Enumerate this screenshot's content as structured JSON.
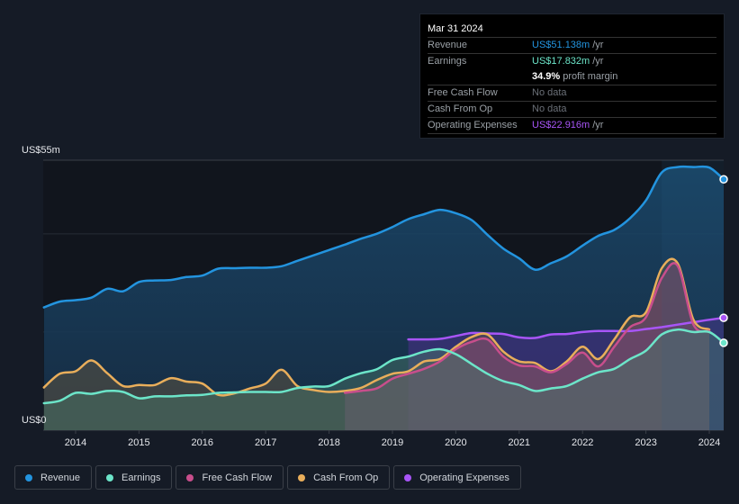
{
  "tooltip": {
    "date": "Mar 31 2024",
    "rows": [
      {
        "label": "Revenue",
        "value": "US$51.138m",
        "unit": "/yr",
        "color": "#2394df"
      },
      {
        "label": "Earnings",
        "value": "US$17.832m",
        "unit": "/yr",
        "color": "#6ce5c9"
      },
      {
        "label": "",
        "value": "34.9%",
        "unit": "profit margin",
        "color": "#ffffff"
      },
      {
        "label": "Free Cash Flow",
        "value": "No data",
        "unit": "",
        "color": "#6b7078"
      },
      {
        "label": "Cash From Op",
        "value": "No data",
        "unit": "",
        "color": "#6b7078"
      },
      {
        "label": "Operating Expenses",
        "value": "US$22.916m",
        "unit": "/yr",
        "color": "#a855f7"
      }
    ]
  },
  "legend": [
    {
      "label": "Revenue",
      "color": "#2394df"
    },
    {
      "label": "Earnings",
      "color": "#6ce5c9"
    },
    {
      "label": "Free Cash Flow",
      "color": "#c84e8c"
    },
    {
      "label": "Cash From Op",
      "color": "#e9ae5b"
    },
    {
      "label": "Operating Expenses",
      "color": "#a855f7"
    }
  ],
  "chart_data": {
    "type": "area",
    "title": "",
    "xlabel": "",
    "ylabel": "",
    "y_tick_labels": [
      "US$0",
      "US$55m"
    ],
    "ylim": [
      0,
      55
    ],
    "xlim": [
      2013.5,
      2024.25
    ],
    "x_ticks": [
      2014,
      2015,
      2016,
      2017,
      2018,
      2019,
      2020,
      2021,
      2022,
      2023,
      2024
    ],
    "grid": true,
    "legend_position": "bottom-left",
    "series": [
      {
        "name": "Revenue",
        "color": "#2394df",
        "x": [
          2013.5,
          2013.75,
          2014.0,
          2014.25,
          2014.5,
          2014.75,
          2015.0,
          2015.25,
          2015.5,
          2015.75,
          2016.0,
          2016.25,
          2016.5,
          2016.75,
          2017.0,
          2017.25,
          2017.5,
          2017.75,
          2018.0,
          2018.25,
          2018.5,
          2018.75,
          2019.0,
          2019.25,
          2019.5,
          2019.75,
          2020.0,
          2020.25,
          2020.5,
          2020.75,
          2021.0,
          2021.25,
          2021.5,
          2021.75,
          2022.0,
          2022.25,
          2022.5,
          2022.75,
          2023.0,
          2023.25,
          2023.5,
          2023.75,
          2024.0,
          2024.25
        ],
        "values": [
          25,
          26.2,
          26.5,
          27,
          28.8,
          28.3,
          30.2,
          30.5,
          30.6,
          31.2,
          31.5,
          32.9,
          33,
          33.1,
          33.1,
          33.4,
          34.5,
          35.6,
          36.7,
          37.8,
          39,
          40,
          41.4,
          43,
          44,
          44.9,
          44.2,
          42.8,
          39.8,
          37,
          35,
          32.7,
          34,
          35.4,
          37.6,
          39.6,
          40.8,
          43.2,
          46.8,
          52.5,
          53.6,
          53.6,
          53.5,
          51.1
        ]
      },
      {
        "name": "Earnings",
        "color": "#6ce5c9",
        "x": [
          2013.5,
          2013.75,
          2014.0,
          2014.25,
          2014.5,
          2014.75,
          2015.0,
          2015.25,
          2015.5,
          2015.75,
          2016.0,
          2016.25,
          2016.5,
          2016.75,
          2017.0,
          2017.25,
          2017.5,
          2017.75,
          2018.0,
          2018.25,
          2018.5,
          2018.75,
          2019.0,
          2019.25,
          2019.5,
          2019.75,
          2020.0,
          2020.25,
          2020.5,
          2020.75,
          2021.0,
          2021.25,
          2021.5,
          2021.75,
          2022.0,
          2022.25,
          2022.5,
          2022.75,
          2023.0,
          2023.25,
          2023.5,
          2023.75,
          2024.0,
          2024.25
        ],
        "values": [
          5.5,
          6,
          7.6,
          7.4,
          8,
          7.8,
          6.5,
          6.9,
          6.9,
          7.1,
          7.2,
          7.6,
          7.7,
          7.8,
          7.8,
          7.8,
          8.6,
          8.9,
          9,
          10.5,
          11.6,
          12.4,
          14.3,
          15,
          16,
          16.5,
          15.5,
          13.5,
          11.5,
          10,
          9.2,
          8,
          8.5,
          9,
          10.5,
          11.8,
          12.5,
          14.5,
          16.2,
          19.5,
          20.5,
          20,
          20,
          17.8
        ]
      },
      {
        "name": "Free Cash Flow",
        "color": "#c84e8c",
        "x": [
          2018.25,
          2018.5,
          2018.75,
          2019.0,
          2019.25,
          2019.5,
          2019.75,
          2020.0,
          2020.25,
          2020.5,
          2020.75,
          2021.0,
          2021.25,
          2021.5,
          2021.75,
          2022.0,
          2022.25,
          2022.5,
          2022.75,
          2023.0,
          2023.25,
          2023.5,
          2023.75,
          2024.0
        ],
        "values": [
          7.6,
          8,
          8.5,
          10.5,
          11.5,
          12.5,
          14,
          16.5,
          18,
          18.5,
          15,
          13.2,
          13,
          11.8,
          13.5,
          15.8,
          13,
          17,
          21,
          23,
          31,
          33.5,
          21.5,
          20.2
        ]
      },
      {
        "name": "Cash From Op",
        "color": "#e9ae5b",
        "x": [
          2013.5,
          2013.75,
          2014.0,
          2014.25,
          2014.5,
          2014.75,
          2015.0,
          2015.25,
          2015.5,
          2015.75,
          2016.0,
          2016.25,
          2016.5,
          2016.75,
          2017.0,
          2017.25,
          2017.5,
          2017.75,
          2018.0,
          2018.25,
          2018.5,
          2018.75,
          2019.0,
          2019.25,
          2019.5,
          2019.75,
          2020.0,
          2020.25,
          2020.5,
          2020.75,
          2021.0,
          2021.25,
          2021.5,
          2021.75,
          2022.0,
          2022.25,
          2022.5,
          2022.75,
          2023.0,
          2023.25,
          2023.5,
          2023.75,
          2024.0
        ],
        "values": [
          8.7,
          11.5,
          12,
          14.2,
          11.6,
          9,
          9.2,
          9.2,
          10.6,
          9.9,
          9.5,
          7.2,
          7.5,
          8.5,
          9.5,
          12.3,
          9,
          8.2,
          7.8,
          8,
          8.6,
          10.2,
          11.5,
          12,
          14,
          14.5,
          17,
          19,
          19.5,
          16,
          14,
          13.7,
          12,
          14,
          17,
          14.5,
          18.5,
          23,
          24,
          33,
          34,
          22.5,
          20.5
        ]
      },
      {
        "name": "Operating Expenses",
        "color": "#a855f7",
        "x": [
          2019.25,
          2019.5,
          2019.75,
          2020.0,
          2020.25,
          2020.5,
          2020.75,
          2021.0,
          2021.25,
          2021.5,
          2021.75,
          2022.0,
          2022.25,
          2022.5,
          2022.75,
          2023.0,
          2023.25,
          2023.5,
          2023.75,
          2024.0,
          2024.25
        ],
        "values": [
          18.5,
          18.5,
          18.6,
          19.2,
          19.8,
          19.7,
          19.6,
          18.9,
          18.8,
          19.5,
          19.6,
          20,
          20.2,
          20.2,
          20.2,
          20.6,
          21,
          21.5,
          22,
          22.5,
          22.9
        ]
      }
    ]
  }
}
